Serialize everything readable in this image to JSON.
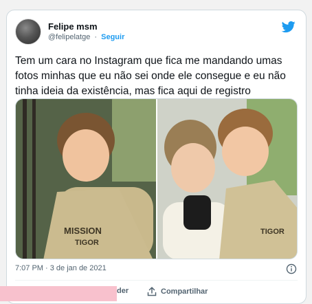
{
  "tweet": {
    "author_name": "Felipe msm",
    "handle": "@felipelatge",
    "separator": "·",
    "follow_label": "Seguir",
    "text": "Tem um cara no Instagram que fica me mandando umas fotos minhas que eu não sei onde ele consegue e eu não tinha ideia da existência, mas fica aqui de registro",
    "timestamp": "7:07 PM · 3 de jan de 2021",
    "actions": {
      "reply_label_partial": "der",
      "share_label": "Compartilhar"
    },
    "photo_captions": {
      "left_shirt": "MISSION",
      "left_shirt2": "TIGOR",
      "right_shirt": "TIGOR"
    }
  },
  "colors": {
    "brand_blue": "#1d9bf0",
    "text_primary": "#0f1419",
    "text_secondary": "#536471",
    "redaction_pink": "#f8c1cd"
  },
  "icons": [
    "twitter-bird-icon",
    "info-icon",
    "share-icon"
  ]
}
